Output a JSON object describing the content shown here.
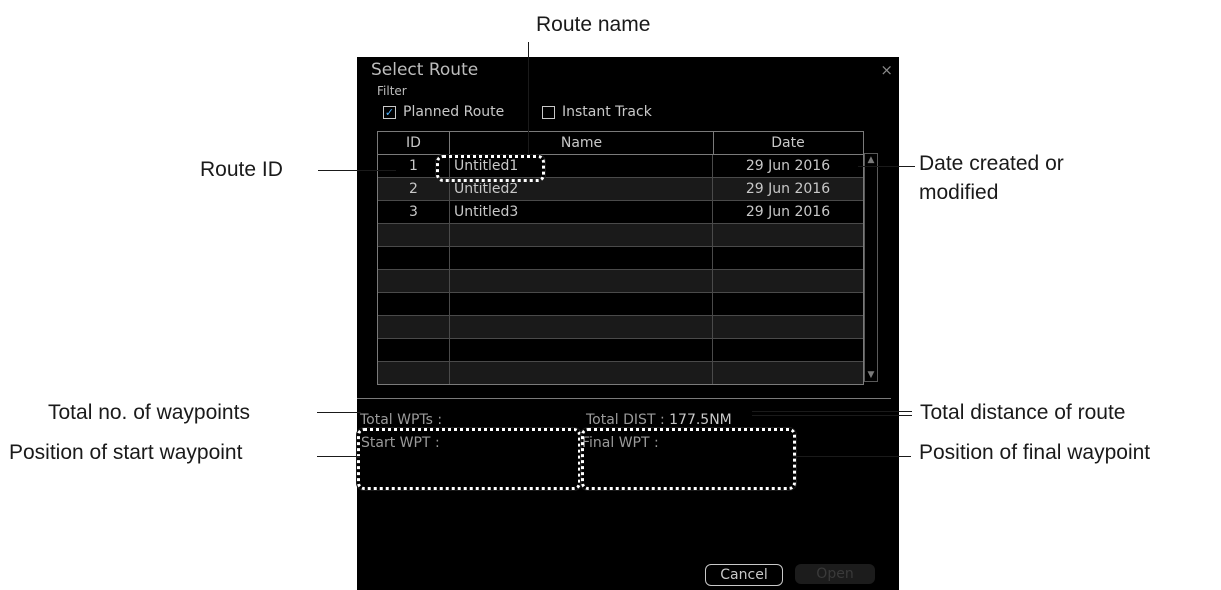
{
  "callouts": {
    "route_name": "Route name",
    "route_id": "Route ID",
    "date": "Date created or",
    "date_2": "modified",
    "total_wpts": "Total no. of waypoints",
    "total_dist": "Total distance of route",
    "start_wpt": "Position of start waypoint",
    "final_wpt": "Position of final waypoint"
  },
  "dialog": {
    "title": "Select Route",
    "close": "×",
    "filter_label": "Filter",
    "filters": [
      {
        "label": "Planned Route",
        "checked": true
      },
      {
        "label": "Instant Track",
        "checked": false
      }
    ],
    "columns": [
      "ID",
      "Name",
      "Date"
    ],
    "rows": [
      {
        "id": "1",
        "name": "Untitled1",
        "date": "29 Jun 2016"
      },
      {
        "id": "2",
        "name": "Untitled2",
        "date": "29 Jun 2016"
      },
      {
        "id": "3",
        "name": "Untitled3",
        "date": "29 Jun 2016"
      }
    ],
    "total_wpts_label": "Total WPTs :",
    "total_dist_label": "Total DIST :",
    "total_dist_value": "177.5NM",
    "start_wpt_label": "Start WPT :",
    "final_wpt_label": "Final WPT :",
    "cancel": "Cancel",
    "open": "Open"
  },
  "colors": {
    "checkbox_check": "#4fb3ff",
    "dialog_bg": "#000000"
  },
  "icons": [
    "checkbox-checked-icon",
    "checkbox-unchecked-icon",
    "close-icon",
    "scroll-up-icon",
    "scroll-down-icon"
  ]
}
